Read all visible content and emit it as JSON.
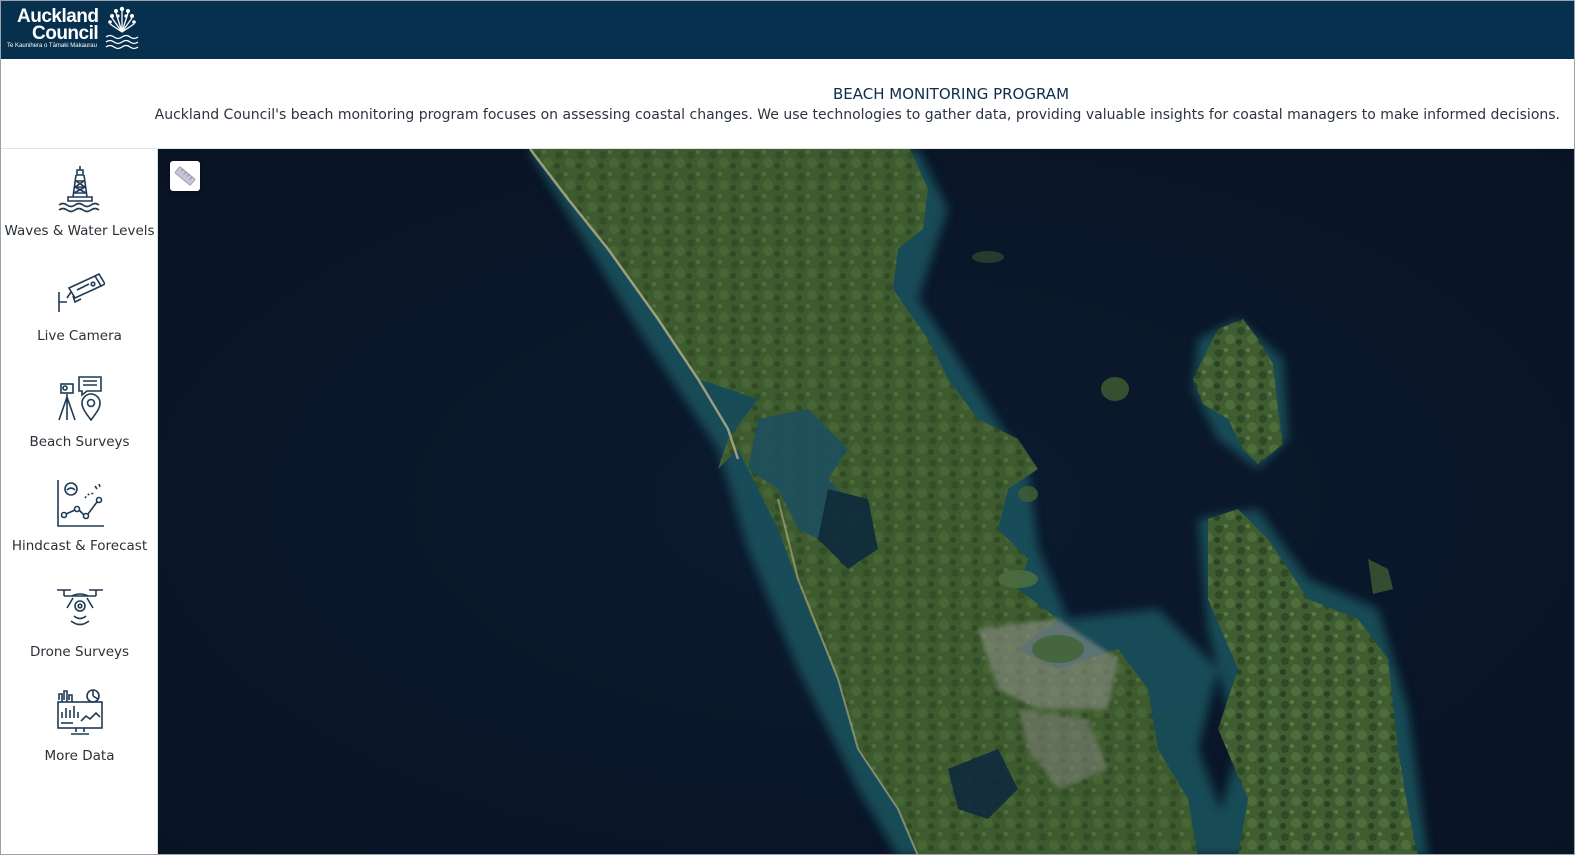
{
  "brand": {
    "name_line1": "Auckland",
    "name_line2": "Council",
    "tagline": "Te Kaunihera o Tāmaki Makaurau"
  },
  "header": {
    "title": "BEACH MONITORING PROGRAM",
    "description": "Auckland Council's beach monitoring program focuses on assessing coastal changes. We use technologies to gather data, providing valuable insights for coastal managers to make informed decisions."
  },
  "sidebar": {
    "items": [
      {
        "label": "Waves & Water Levels",
        "icon": "buoy-waves-icon"
      },
      {
        "label": "Live Camera",
        "icon": "security-camera-icon"
      },
      {
        "label": "Beach Surveys",
        "icon": "survey-tripod-pin-icon"
      },
      {
        "label": "Hindcast & Forecast",
        "icon": "forecast-chart-icon"
      },
      {
        "label": "Drone Surveys",
        "icon": "drone-icon"
      },
      {
        "label": "More Data",
        "icon": "dashboard-monitor-icon"
      }
    ]
  },
  "map": {
    "tool_icon": "ruler-icon",
    "colors": {
      "ocean": "#0a1526",
      "land": "#3b5a2e",
      "shallow": "#2d6f70"
    }
  },
  "colors": {
    "topbar": "#07304f",
    "title": "#0d2d4b"
  }
}
